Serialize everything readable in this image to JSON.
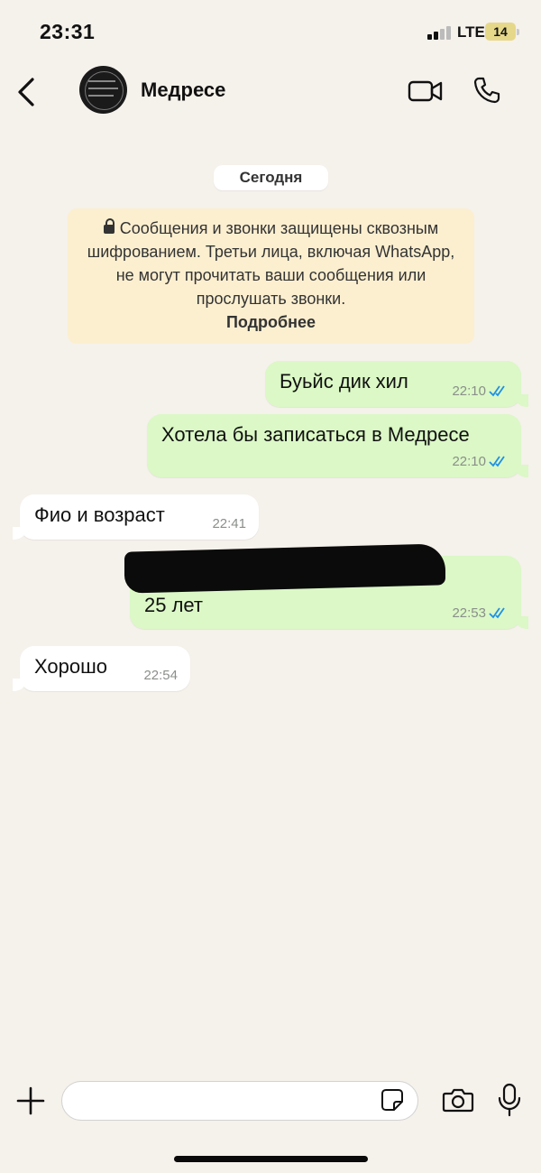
{
  "status_bar": {
    "time": "23:31",
    "network": "LTE",
    "battery": "14"
  },
  "header": {
    "contact_name": "Медресе",
    "icons": [
      "back-icon",
      "video-call-icon",
      "phone-icon"
    ]
  },
  "chat": {
    "date_label": "Сегодня",
    "encryption_notice": {
      "text": "Сообщения и звонки защищены сквозным шифрованием. Третьи лица, включая WhatsApp, не могут прочитать ваши сообщения или прослушать звонки.",
      "link": "Подробнее"
    },
    "messages": [
      {
        "direction": "out",
        "text": "Буьйс дик хил",
        "time": "22:10",
        "read": true
      },
      {
        "direction": "out",
        "text": "Хотела бы записаться в Медресе",
        "time": "22:10",
        "read": true
      },
      {
        "direction": "in",
        "text": "Фио и возраст",
        "time": "22:41"
      },
      {
        "direction": "out",
        "text": "25 лет",
        "time": "22:53",
        "read": true,
        "redacted_line": true
      },
      {
        "direction": "in",
        "text": "Хорошо",
        "time": "22:54"
      }
    ]
  },
  "composer": {
    "value": "",
    "icons": [
      "plus-icon",
      "sticker-icon",
      "camera-icon",
      "microphone-icon"
    ]
  },
  "colors": {
    "background": "#f5f1eb",
    "outgoing_bubble": "#dbf8c6",
    "incoming_bubble": "#ffffff",
    "notice_bg": "#fcefd0",
    "read_ticks": "#1e90e6"
  }
}
